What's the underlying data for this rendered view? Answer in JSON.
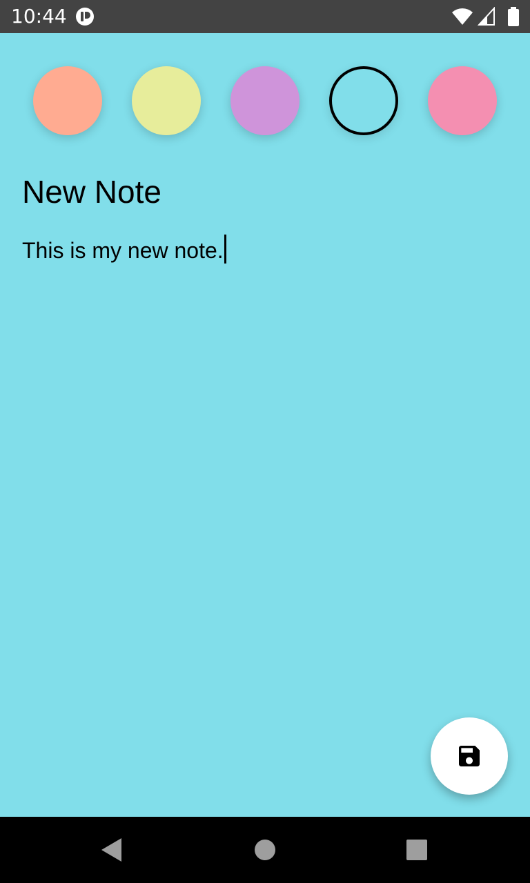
{
  "status_bar": {
    "time": "10:44",
    "icons": [
      "app-notification-icon",
      "wifi-icon",
      "signal-icon",
      "battery-icon"
    ]
  },
  "colors": {
    "background": "#81DEEA",
    "status_bar": "#434343",
    "swatches": [
      "#FFAB91",
      "#E7ED9B",
      "#CF94DA",
      "#81DEEA",
      "#F48FB1"
    ],
    "selected_index": 3
  },
  "note": {
    "title": "New Note",
    "body": "This is my new note."
  },
  "fab": {
    "icon": "save-icon"
  },
  "nav_bar": {
    "icons": [
      "back-icon",
      "home-icon",
      "recents-icon"
    ]
  }
}
